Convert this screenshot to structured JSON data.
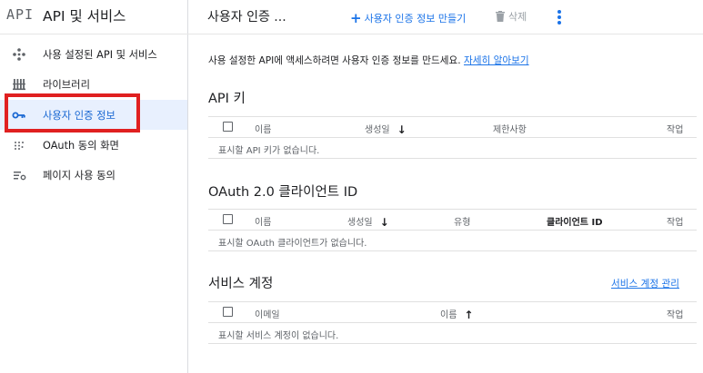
{
  "sidebar": {
    "logo": "API",
    "title": "API 및 서비스",
    "items": [
      {
        "label": "사용 설정된 API 및 서비스",
        "icon": "diamond-dots-icon",
        "active": false
      },
      {
        "label": "라이브러리",
        "icon": "library-icon",
        "active": false
      },
      {
        "label": "사용자 인증 정보",
        "icon": "key-icon",
        "active": true
      },
      {
        "label": "OAuth 동의 화면",
        "icon": "dots-grid-icon",
        "active": false
      },
      {
        "label": "페이지 사용 동의",
        "icon": "settings-list-icon",
        "active": false
      }
    ]
  },
  "header": {
    "title": "사용자 인증 ...",
    "create_label": "사용자 인증 정보 만들기",
    "delete_label": "삭제"
  },
  "main": {
    "description": "사용 설정한 API에 액세스하려면 사용자 인증 정보를 만드세요.",
    "learn_more": "자세히 알아보기",
    "api_keys": {
      "title": "API 키",
      "columns": [
        "이름",
        "생성일",
        "제한사항",
        "작업"
      ],
      "empty": "표시할 API 키가 없습니다."
    },
    "oauth": {
      "title": "OAuth 2.0 클라이언트 ID",
      "columns": [
        "이름",
        "생성일",
        "유형",
        "클라이언트 ID",
        "작업"
      ],
      "empty": "표시할 OAuth 클라이언트가 없습니다."
    },
    "service_accounts": {
      "title": "서비스 계정",
      "manage_link": "서비스 계정 관리",
      "columns": [
        "이메일",
        "이름",
        "작업"
      ],
      "empty": "표시할 서비스 계정이 없습니다."
    }
  },
  "colors": {
    "accent": "#1a73e8",
    "active_bg": "#e8f0fe",
    "highlight": "#e02020"
  }
}
